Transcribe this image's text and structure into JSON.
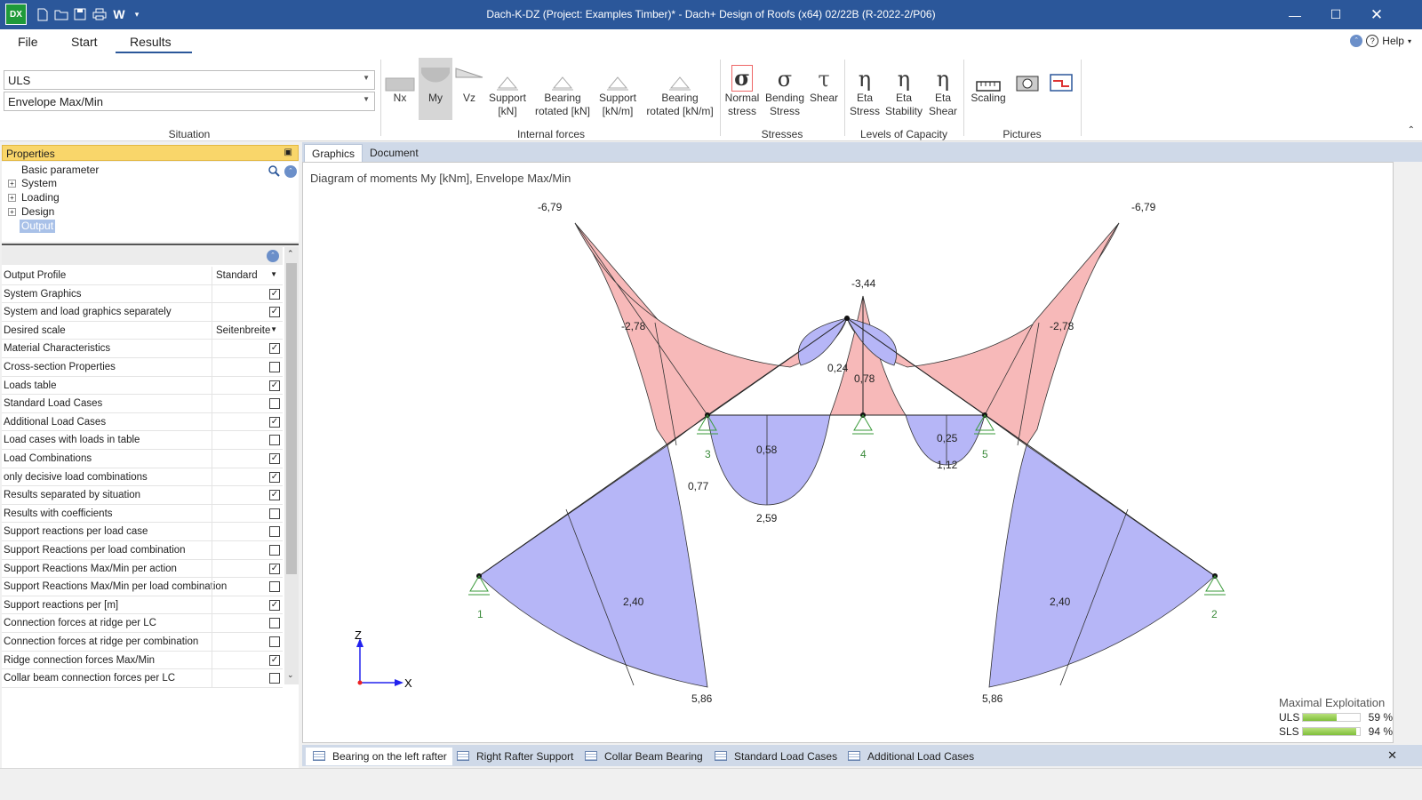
{
  "titlebar": {
    "logo": "DX",
    "title": "Dach-K-DZ (Project: Examples Timber)* - Dach+ Design of Roofs (x64) 02/22B (R-2022-2/P06)",
    "word_letter": "W"
  },
  "menu": {
    "file": "File",
    "start": "Start",
    "results": "Results",
    "help": "Help"
  },
  "ribbon": {
    "situation": {
      "combo1": "ULS",
      "combo2": "Envelope Max/Min",
      "label": "Situation"
    },
    "internal_forces": {
      "label": "Internal forces",
      "nx": "Nx",
      "my": "My",
      "vz": "Vz",
      "support_kn_1": "Support",
      "support_kn_2": "[kN]",
      "bearing_rot_kn_1": "Bearing",
      "bearing_rot_kn_2": "rotated [kN]",
      "support_knm_1": "Support",
      "support_knm_2": "[kN/m]",
      "bearing_rot_knm_1": "Bearing",
      "bearing_rot_knm_2": "rotated [kN/m]"
    },
    "stresses": {
      "label": "Stresses",
      "normal_1": "Normal",
      "normal_2": "stress",
      "bending_1": "Bending",
      "bending_2": "Stress",
      "shear": "Shear"
    },
    "capacity": {
      "label": "Levels of Capacity",
      "eta_stress_1": "Eta",
      "eta_stress_2": "Stress",
      "eta_stab_1": "Eta",
      "eta_stab_2": "Stability",
      "eta_shear_1": "Eta",
      "eta_shear_2": "Shear"
    },
    "pictures": {
      "label": "Pictures",
      "scaling": "Scaling"
    }
  },
  "properties": {
    "header": "Properties",
    "tree": [
      "Basic parameter",
      "System",
      "Loading",
      "Design",
      "Output"
    ],
    "rows": [
      {
        "label": "Output Profile",
        "type": "drop",
        "value": "Standard"
      },
      {
        "label": "System Graphics",
        "type": "check",
        "checked": true
      },
      {
        "label": "System and load graphics separately",
        "type": "check",
        "checked": true
      },
      {
        "label": "Desired scale",
        "type": "drop",
        "value": "Seitenbreite"
      },
      {
        "label": "Material Characteristics",
        "type": "check",
        "checked": true
      },
      {
        "label": "Cross-section Properties",
        "type": "check",
        "checked": false
      },
      {
        "label": "Loads table",
        "type": "check",
        "checked": true
      },
      {
        "label": "Standard Load Cases",
        "type": "check",
        "checked": false
      },
      {
        "label": "Additional Load Cases",
        "type": "check",
        "checked": true
      },
      {
        "label": "Load cases with loads in table",
        "type": "check",
        "checked": false
      },
      {
        "label": "Load Combinations",
        "type": "check",
        "checked": true
      },
      {
        "label": "only decisive load combinations",
        "type": "check",
        "checked": true
      },
      {
        "label": "Results separated by situation",
        "type": "check",
        "checked": true
      },
      {
        "label": "Results with coefficients",
        "type": "check",
        "checked": false
      },
      {
        "label": "Support reactions per load case",
        "type": "check",
        "checked": false
      },
      {
        "label": "Support Reactions per load combination",
        "type": "check",
        "checked": false
      },
      {
        "label": "Support Reactions Max/Min per action",
        "type": "check",
        "checked": true
      },
      {
        "label": "Support Reactions Max/Min per load combination",
        "type": "check",
        "checked": false
      },
      {
        "label": "Support reactions per [m]",
        "type": "check",
        "checked": true
      },
      {
        "label": "Connection forces at ridge per LC",
        "type": "check",
        "checked": false
      },
      {
        "label": "Connection forces at ridge per combination",
        "type": "check",
        "checked": false
      },
      {
        "label": "Ridge connection forces Max/Min",
        "type": "check",
        "checked": true
      },
      {
        "label": "Collar beam connection forces per LC",
        "type": "check",
        "checked": false
      }
    ]
  },
  "graphics": {
    "tab_graphics": "Graphics",
    "tab_document": "Document",
    "diagram_title": "Diagram of moments My [kNm], Envelope Max/Min",
    "labels": {
      "m1": "-6,79",
      "m2": "-6,79",
      "m3": "-3,44",
      "m4": "-2,78",
      "m5": "-2,78",
      "m6": "0,24",
      "m7": "0,78",
      "m8": "0,58",
      "m9": "2,59",
      "m10": "0,25",
      "m11": "1,12",
      "m12": "0,77",
      "m13": "2,40",
      "m14": "2,40",
      "m15": "5,86",
      "m16": "5,86"
    },
    "supports": {
      "s1": "1",
      "s2": "2",
      "s3": "3",
      "s4": "4",
      "s5": "5"
    },
    "axis_z": "Z",
    "axis_x": "X",
    "exploitation": {
      "title": "Maximal Exploitation",
      "uls_label": "ULS",
      "uls_pct": "59 %",
      "uls_value": 0.59,
      "sls_label": "SLS",
      "sls_pct": "94 %",
      "sls_value": 0.94
    },
    "colors": {
      "negative": "#f4a6a6",
      "positive": "#a8a8f4"
    }
  },
  "bottom_tabs": [
    "Bearing on the left rafter",
    "Right Rafter Support",
    "Collar Beam Bearing",
    "Standard Load Cases",
    "Additional Load Cases"
  ]
}
